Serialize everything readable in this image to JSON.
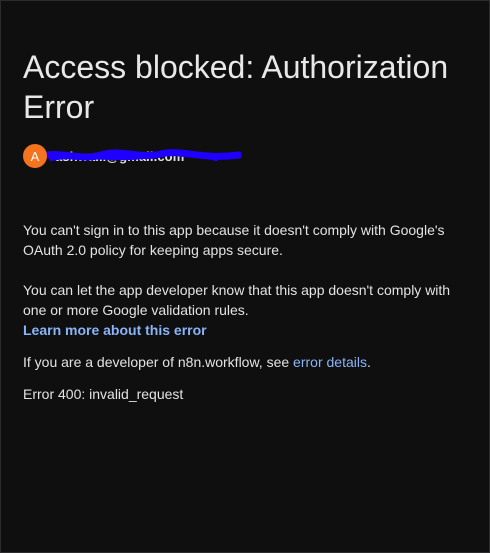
{
  "page": {
    "title": "Access blocked: Authorization Error"
  },
  "account": {
    "avatar_letter": "A",
    "email_fragment": "ashwa...@gmail.com",
    "avatar_color": "#f4731f",
    "redaction_color": "#1f00ff"
  },
  "content": {
    "paragraph1": "You can't sign in to this app because it doesn't comply with Google's OAuth 2.0 policy for keeping apps secure.",
    "paragraph2": "You can let the app developer know that this app doesn't comply with one or more Google validation rules.",
    "learn_more_label": "Learn more about this error",
    "developer_prefix": "If you are a developer of n8n.workflow, see ",
    "error_details_label": "error details",
    "developer_suffix": ".",
    "error_code": "Error 400: invalid_request"
  },
  "colors": {
    "background": "#0f0f10",
    "text": "#e3e3e3",
    "link": "#8ab4f8"
  }
}
